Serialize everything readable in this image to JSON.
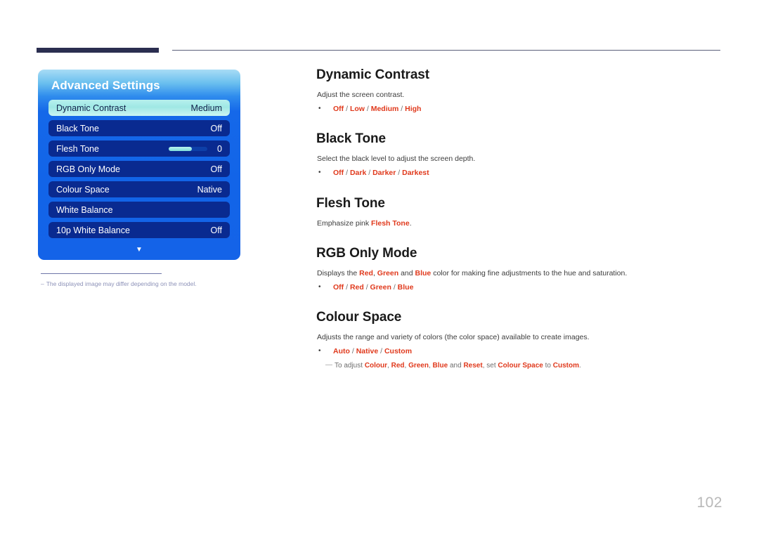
{
  "page": {
    "number": "102"
  },
  "osd": {
    "title": "Advanced Settings",
    "rows": [
      {
        "label": "Dynamic Contrast",
        "value": "Medium",
        "selected": true,
        "type": "value"
      },
      {
        "label": "Black Tone",
        "value": "Off",
        "selected": false,
        "type": "value"
      },
      {
        "label": "Flesh Tone",
        "value": "0",
        "selected": false,
        "type": "slider",
        "slider_fill_percent": 60
      },
      {
        "label": "RGB Only Mode",
        "value": "Off",
        "selected": false,
        "type": "value"
      },
      {
        "label": "Colour Space",
        "value": "Native",
        "selected": false,
        "type": "value"
      },
      {
        "label": "White Balance",
        "value": "",
        "selected": false,
        "type": "value"
      },
      {
        "label": "10p White Balance",
        "value": "Off",
        "selected": false,
        "type": "value"
      }
    ],
    "more_arrow_icon": "chevron-down-icon",
    "footnote_dash": "–",
    "footnote": "The displayed image may differ depending on the model."
  },
  "sections": [
    {
      "heading": "Dynamic Contrast",
      "description": "Adjust the screen contrast.",
      "bullet_dot": "•",
      "options": [
        "Off",
        "Low",
        "Medium",
        "High"
      ]
    },
    {
      "heading": "Black Tone",
      "description": "Select the black level to adjust the screen depth.",
      "bullet_dot": "•",
      "options": [
        "Off",
        "Dark",
        "Darker",
        "Darkest"
      ]
    },
    {
      "heading": "Flesh Tone",
      "description_pre": "Emphasize pink ",
      "description_hl": "Flesh Tone",
      "description_post": "."
    },
    {
      "heading": "RGB Only Mode",
      "desc_parts": [
        {
          "t": "Displays the ",
          "hl": false
        },
        {
          "t": "Red",
          "hl": true
        },
        {
          "t": ", ",
          "hl": false
        },
        {
          "t": "Green",
          "hl": true
        },
        {
          "t": " and ",
          "hl": false
        },
        {
          "t": "Blue",
          "hl": true
        },
        {
          "t": " color for making fine adjustments to the hue and saturation.",
          "hl": false
        }
      ],
      "bullet_dot": "•",
      "options": [
        "Off",
        "Red",
        "Green",
        "Blue"
      ]
    },
    {
      "heading": "Colour Space",
      "description": "Adjusts the range and variety of colors (the color space) available to create images.",
      "bullet_dot": "•",
      "options": [
        "Auto",
        "Native",
        "Custom"
      ],
      "note_dash": "—",
      "note_parts": [
        {
          "t": "To adjust ",
          "hl": false
        },
        {
          "t": "Colour",
          "hl": true
        },
        {
          "t": ", ",
          "hl": false
        },
        {
          "t": "Red",
          "hl": true
        },
        {
          "t": ", ",
          "hl": false
        },
        {
          "t": "Green",
          "hl": true
        },
        {
          "t": ", ",
          "hl": false
        },
        {
          "t": "Blue",
          "hl": true
        },
        {
          "t": " and ",
          "hl": false
        },
        {
          "t": "Reset",
          "hl": true
        },
        {
          "t": ", set ",
          "hl": false
        },
        {
          "t": "Colour Space",
          "hl": true
        },
        {
          "t": " to ",
          "hl": false
        },
        {
          "t": "Custom",
          "hl": true
        },
        {
          "t": ".",
          "hl": false
        }
      ]
    }
  ],
  "colors": {
    "highlight": "#e0391c",
    "rule_dark": "#2b2e50",
    "panel_blue": "#1264e8",
    "row_navy": "#092a90",
    "row_selected": "#9fe8e4"
  }
}
